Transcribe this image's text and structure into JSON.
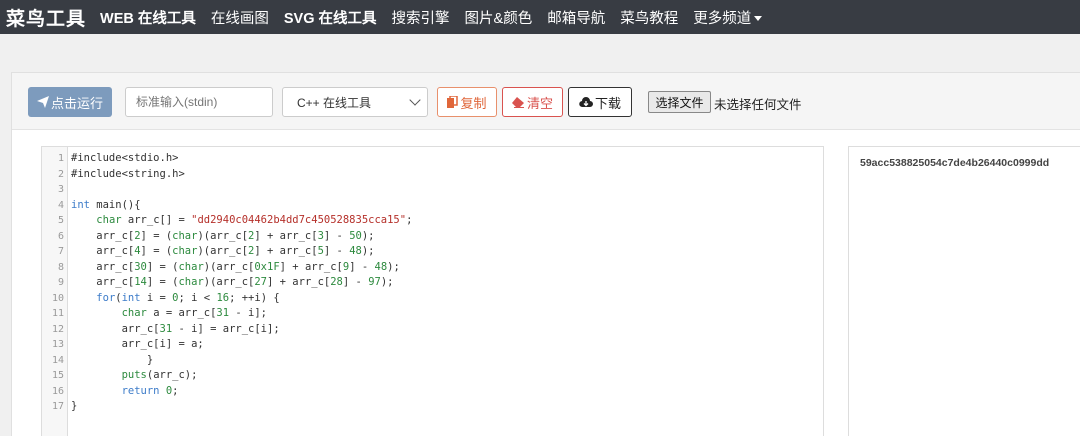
{
  "navbar": {
    "brand": "菜鸟工具",
    "items": [
      "WEB 在线工具",
      "在线画图",
      "SVG 在线工具",
      "搜索引擎",
      "图片&颜色",
      "邮箱导航",
      "菜鸟教程",
      "更多频道"
    ]
  },
  "toolbar": {
    "run_label": "点击运行",
    "stdin_placeholder": "标准输入(stdin)",
    "language_selected": "C++ 在线工具",
    "copy_label": "复制",
    "clear_label": "清空",
    "download_label": "下载",
    "file_button_label": "选择文件",
    "file_status": "未选择任何文件"
  },
  "editor": {
    "lines": [
      "#include<stdio.h>",
      "#include<string.h>",
      "",
      "int main(){",
      "    char arr_c[] = \"dd2940c04462b4dd7c450528835cca15\";",
      "    arr_c[2] = (char)(arr_c[2] + arr_c[3] - 50);",
      "    arr_c[4] = (char)(arr_c[2] + arr_c[5] - 48);",
      "    arr_c[30] = (char)(arr_c[0x1F] + arr_c[9] - 48);",
      "    arr_c[14] = (char)(arr_c[27] + arr_c[28] - 97);",
      "    for(int i = 0; i < 16; ++i) {",
      "        char a = arr_c[31 - i];",
      "        arr_c[31 - i] = arr_c[i];",
      "        arr_c[i] = a;",
      "            }",
      "        puts(arr_c);",
      "        return 0;",
      "}"
    ],
    "line_numbers": [
      "1",
      "2",
      "3",
      "4",
      "5",
      "6",
      "7",
      "8",
      "9",
      "10",
      "11",
      "12",
      "13",
      "14",
      "15",
      "16",
      "17"
    ]
  },
  "output": {
    "text": "59acc538825054c7de4b26440c0999dd"
  },
  "colors": {
    "navbar_bg": "#383c43",
    "run_button": "#7d9bbd",
    "copy": "#e0663a",
    "clear": "#d9534f"
  }
}
